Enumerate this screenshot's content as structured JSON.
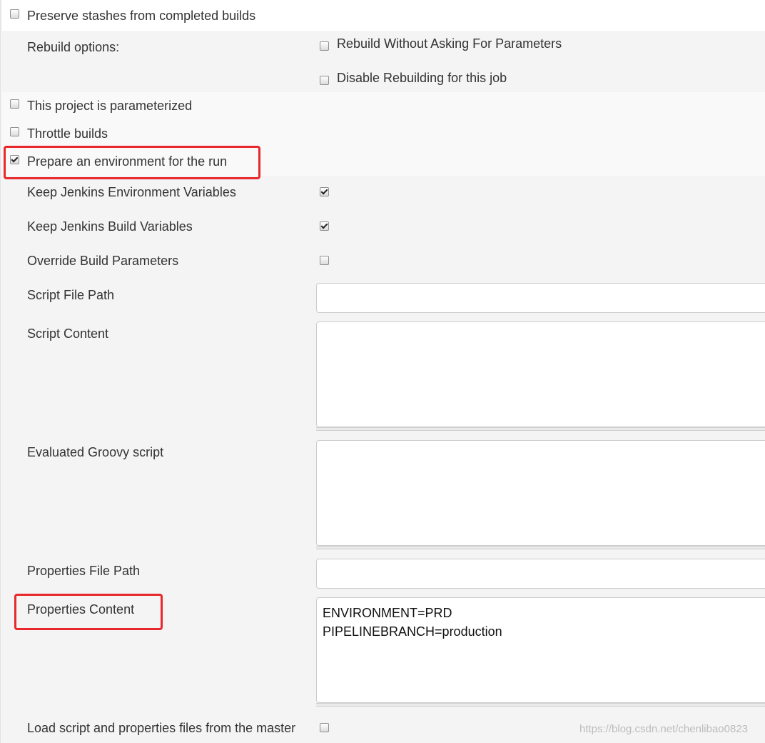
{
  "options": {
    "preserve_stashes": {
      "label": "Preserve stashes from completed builds",
      "checked": false
    },
    "rebuild_options_label": "Rebuild options:",
    "rebuild_without_asking": {
      "label": "Rebuild Without Asking For Parameters",
      "checked": false
    },
    "disable_rebuilding": {
      "label": "Disable Rebuilding for this job",
      "checked": false
    },
    "parameterized": {
      "label": "This project is parameterized",
      "checked": false
    },
    "throttle": {
      "label": "Throttle builds",
      "checked": false
    },
    "prepare_env": {
      "label": "Prepare an environment for the run",
      "checked": true
    }
  },
  "env": {
    "keep_env_vars": {
      "label": "Keep Jenkins Environment Variables",
      "checked": true
    },
    "keep_build_vars": {
      "label": "Keep Jenkins Build Variables",
      "checked": true
    },
    "override_params": {
      "label": "Override Build Parameters",
      "checked": false
    },
    "script_file_path": {
      "label": "Script File Path",
      "value": ""
    },
    "script_content": {
      "label": "Script Content",
      "value": ""
    },
    "groovy_script": {
      "label": "Evaluated Groovy script",
      "value": ""
    },
    "properties_file_path": {
      "label": "Properties File Path",
      "value": ""
    },
    "properties_content": {
      "label": "Properties Content",
      "value": "ENVIRONMENT=PRD\nPIPELINEBRANCH=production"
    },
    "load_from_master": {
      "label": "Load script and properties files from the master",
      "checked": false
    }
  },
  "highlight_color": "#e8282b",
  "watermark": "https://blog.csdn.net/chenlibao0823"
}
